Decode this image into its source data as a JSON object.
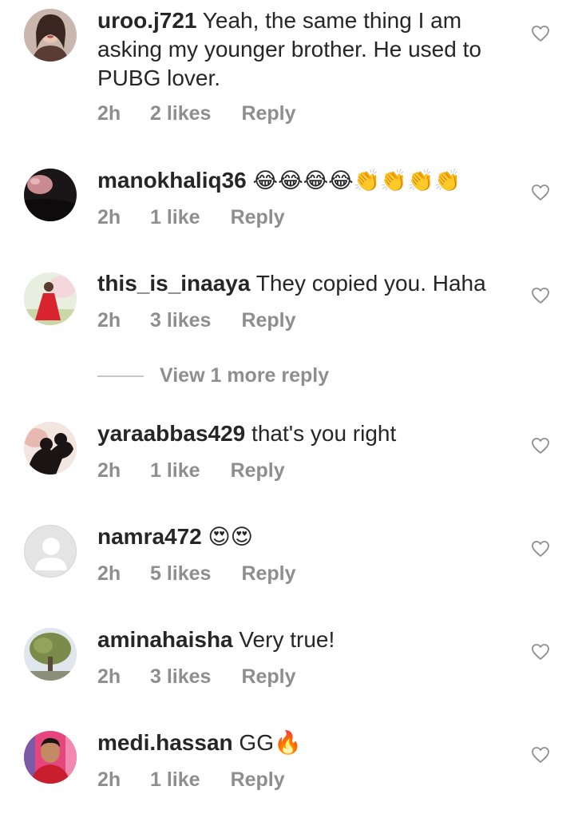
{
  "comments": [
    {
      "username": "uroo.j721",
      "text": "Yeah, the same thing I am asking my younger brother. He used to PUBG lover.",
      "time": "2h",
      "likes": "2 likes",
      "reply": "Reply",
      "avatar_icon": "woman-portrait"
    },
    {
      "username": "manokhaliq36",
      "text": "😂😂😂😂👏👏👏👏",
      "time": "2h",
      "likes": "1 like",
      "reply": "Reply",
      "avatar_icon": "dark-photo"
    },
    {
      "username": "this_is_inaaya",
      "text": "They copied you. Haha",
      "time": "2h",
      "likes": "3 likes",
      "reply": "Reply",
      "avatar_icon": "girl-red-dress"
    },
    {
      "username": "yaraabbas429",
      "text": "that's you right",
      "time": "2h",
      "likes": "1 like",
      "reply": "Reply",
      "avatar_icon": "silhouette-couple"
    },
    {
      "username": "namra472",
      "text": "😍😍",
      "time": "2h",
      "likes": "5 likes",
      "reply": "Reply",
      "avatar_icon": "default-avatar"
    },
    {
      "username": "aminahaisha",
      "text": "Very true!",
      "time": "2h",
      "likes": "3 likes",
      "reply": "Reply",
      "avatar_icon": "tree"
    },
    {
      "username": "medi.hassan",
      "text": "GG🔥",
      "time": "2h",
      "likes": "1 like",
      "reply": "Reply",
      "avatar_icon": "man-portrait"
    }
  ],
  "view_more": "View 1 more reply",
  "colors": {
    "text": "#262626",
    "meta": "#8e8e8e",
    "heart_stroke": "#8e8e8e"
  }
}
